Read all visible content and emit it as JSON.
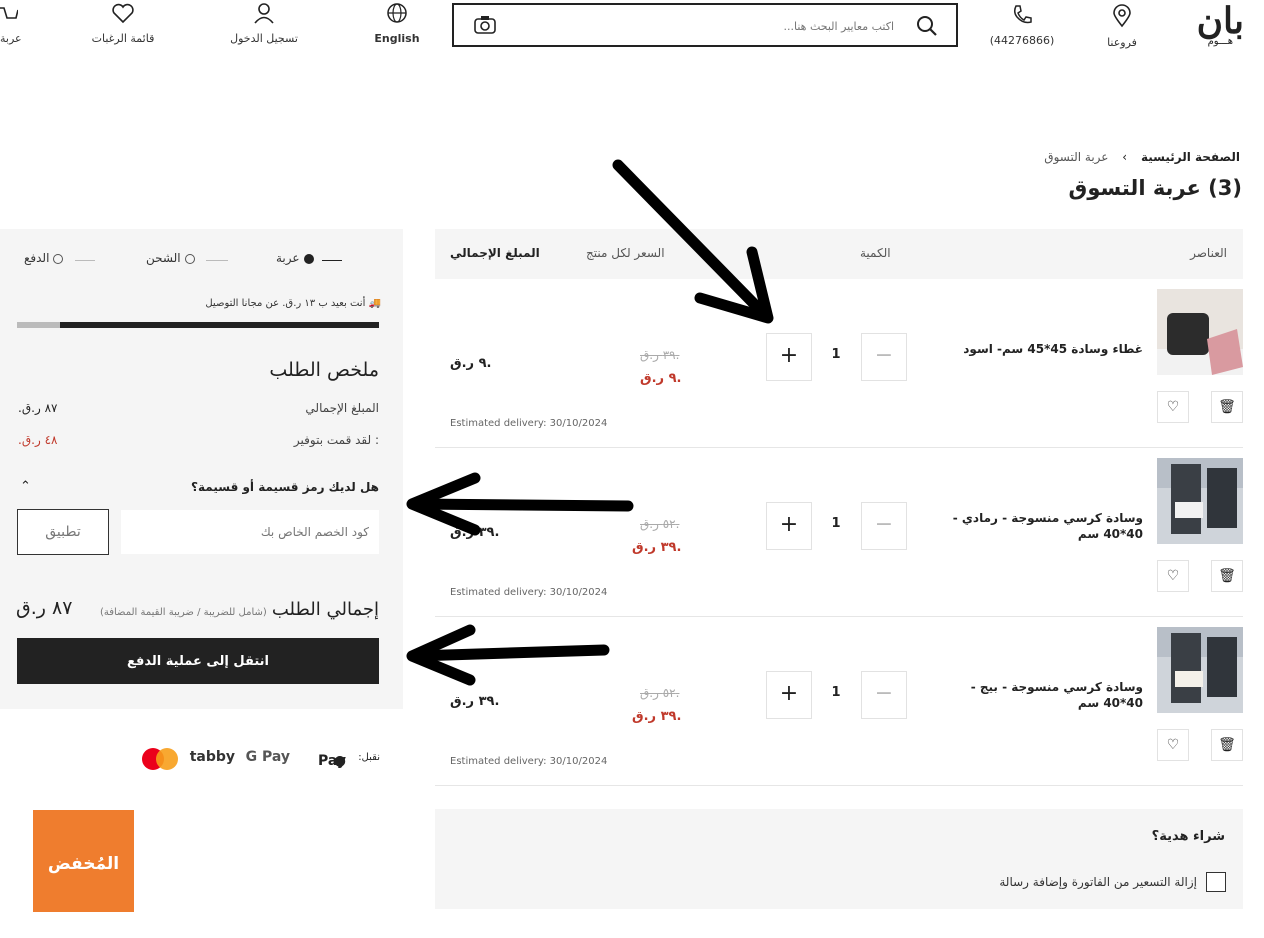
{
  "header": {
    "logo_main": "بان",
    "logo_sub": "هـــوم",
    "branches_label": "فروعنا",
    "phone_label": "(44276866)",
    "search_placeholder": "اكتب معايير البحث هنا...",
    "language_label": "English",
    "login_label": "تسجيل الدخول",
    "wishlist_label": "قائمة الرغبات",
    "cart_label": "عربة"
  },
  "breadcrumb": {
    "home": "الصفحة الرئيسية",
    "separator": "›",
    "current": "عربة التسوق"
  },
  "page_title": "(3) عربة التسوق",
  "table_header": {
    "items": "العناصر",
    "quantity": "الكمية",
    "unit_price": "السعر لكل منتج",
    "total": "المبلغ الإجمالي"
  },
  "items": [
    {
      "name": "غطاء وسادة 45*45 سم- اسود",
      "qty": "1",
      "old_price": "٣٩ ر.ق.",
      "new_price": "٩ ر.ق.",
      "total": "٩ ر.ق.",
      "delivery": "Estimated delivery: 30/10/2024"
    },
    {
      "name": "وسادة كرسي منسوجة - رمادي - 40*40 سم",
      "qty": "1",
      "old_price": "٥٢ ر.ق.",
      "new_price": "٣٩ ر.ق.",
      "total": "٣٩ ر.ق.",
      "delivery": "Estimated delivery: 30/10/2024"
    },
    {
      "name": "وسادة كرسي منسوجة - بيج - 40*40 سم",
      "qty": "1",
      "old_price": "٥٢ ر.ق.",
      "new_price": "٣٩ ر.ق.",
      "total": "٣٩ ر.ق.",
      "delivery": "Estimated delivery: 30/10/2024"
    }
  ],
  "checkout_steps": {
    "cart": "عربة",
    "shipping": "الشحن",
    "payment": "الدفع"
  },
  "shipping_note": "أنت بعيد ب ١٣ ر.ق. عن مجانا التوصيل",
  "shipping_progress": 0.12,
  "summary": {
    "title": "ملخص الطلب",
    "total_label": "المبلغ الإجمالي",
    "total_value": "٨٧ ر.ق.",
    "savings_label": ": لقد قمت بتوفير",
    "savings_value": "٤٨ ر.ق.",
    "promo_question": "هل لديك رمز قسيمة أو قسيمة؟",
    "promo_placeholder": "كود الخصم الخاص بك",
    "apply_label": "تطبيق",
    "grand_total_label": "إجمالي الطلب",
    "grand_total_note": "(شامل للضريبة / ضريبة القيمة المضافة)",
    "grand_total_value": "٨٧ ر.ق",
    "checkout_label": "انتقل إلى عملية الدفع"
  },
  "payments": {
    "accept_label": "نقبل:",
    "methods": [
      "Pay",
      "G Pay",
      "tabby"
    ]
  },
  "gift": {
    "title": "شراء هدية؟",
    "checkbox_label": "إزالة التسعير من الفاتورة وإضافة رسالة"
  },
  "badge": {
    "text": "المُخفض"
  },
  "colors": {
    "dark": "#222222",
    "sale_red": "#c0392b",
    "panel_bg": "#f5f5f5",
    "badge_orange": "#ef7d2e",
    "mastercard_red": "#eb001b",
    "mastercard_yellow": "#f79e1b"
  }
}
